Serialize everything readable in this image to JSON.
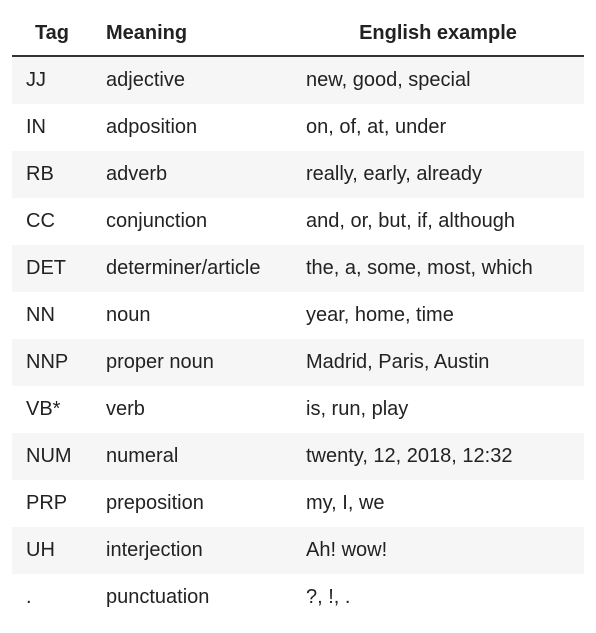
{
  "table": {
    "headers": {
      "tag": "Tag",
      "meaning": "Meaning",
      "example": "English example"
    },
    "rows": [
      {
        "tag": "JJ",
        "meaning": "adjective",
        "example": "new, good, special"
      },
      {
        "tag": "IN",
        "meaning": "adposition",
        "example": "on, of, at, under"
      },
      {
        "tag": "RB",
        "meaning": "adverb",
        "example": "really, early, already"
      },
      {
        "tag": "CC",
        "meaning": "conjunction",
        "example": "and, or, but, if, although"
      },
      {
        "tag": "DET",
        "meaning": "determiner/article",
        "example": "the, a, some, most, which"
      },
      {
        "tag": "NN",
        "meaning": "noun",
        "example": "year, home, time"
      },
      {
        "tag": "NNP",
        "meaning": "proper noun",
        "example": "Madrid, Paris, Austin"
      },
      {
        "tag": "VB*",
        "meaning": "verb",
        "example": "is, run, play"
      },
      {
        "tag": "NUM",
        "meaning": "numeral",
        "example": "twenty, 12, 2018, 12:32"
      },
      {
        "tag": "PRP",
        "meaning": "preposition",
        "example": "my, I, we"
      },
      {
        "tag": "UH",
        "meaning": "interjection",
        "example": "Ah! wow!"
      },
      {
        "tag": ".",
        "meaning": "punctuation",
        "example": "?, !, ."
      }
    ]
  }
}
